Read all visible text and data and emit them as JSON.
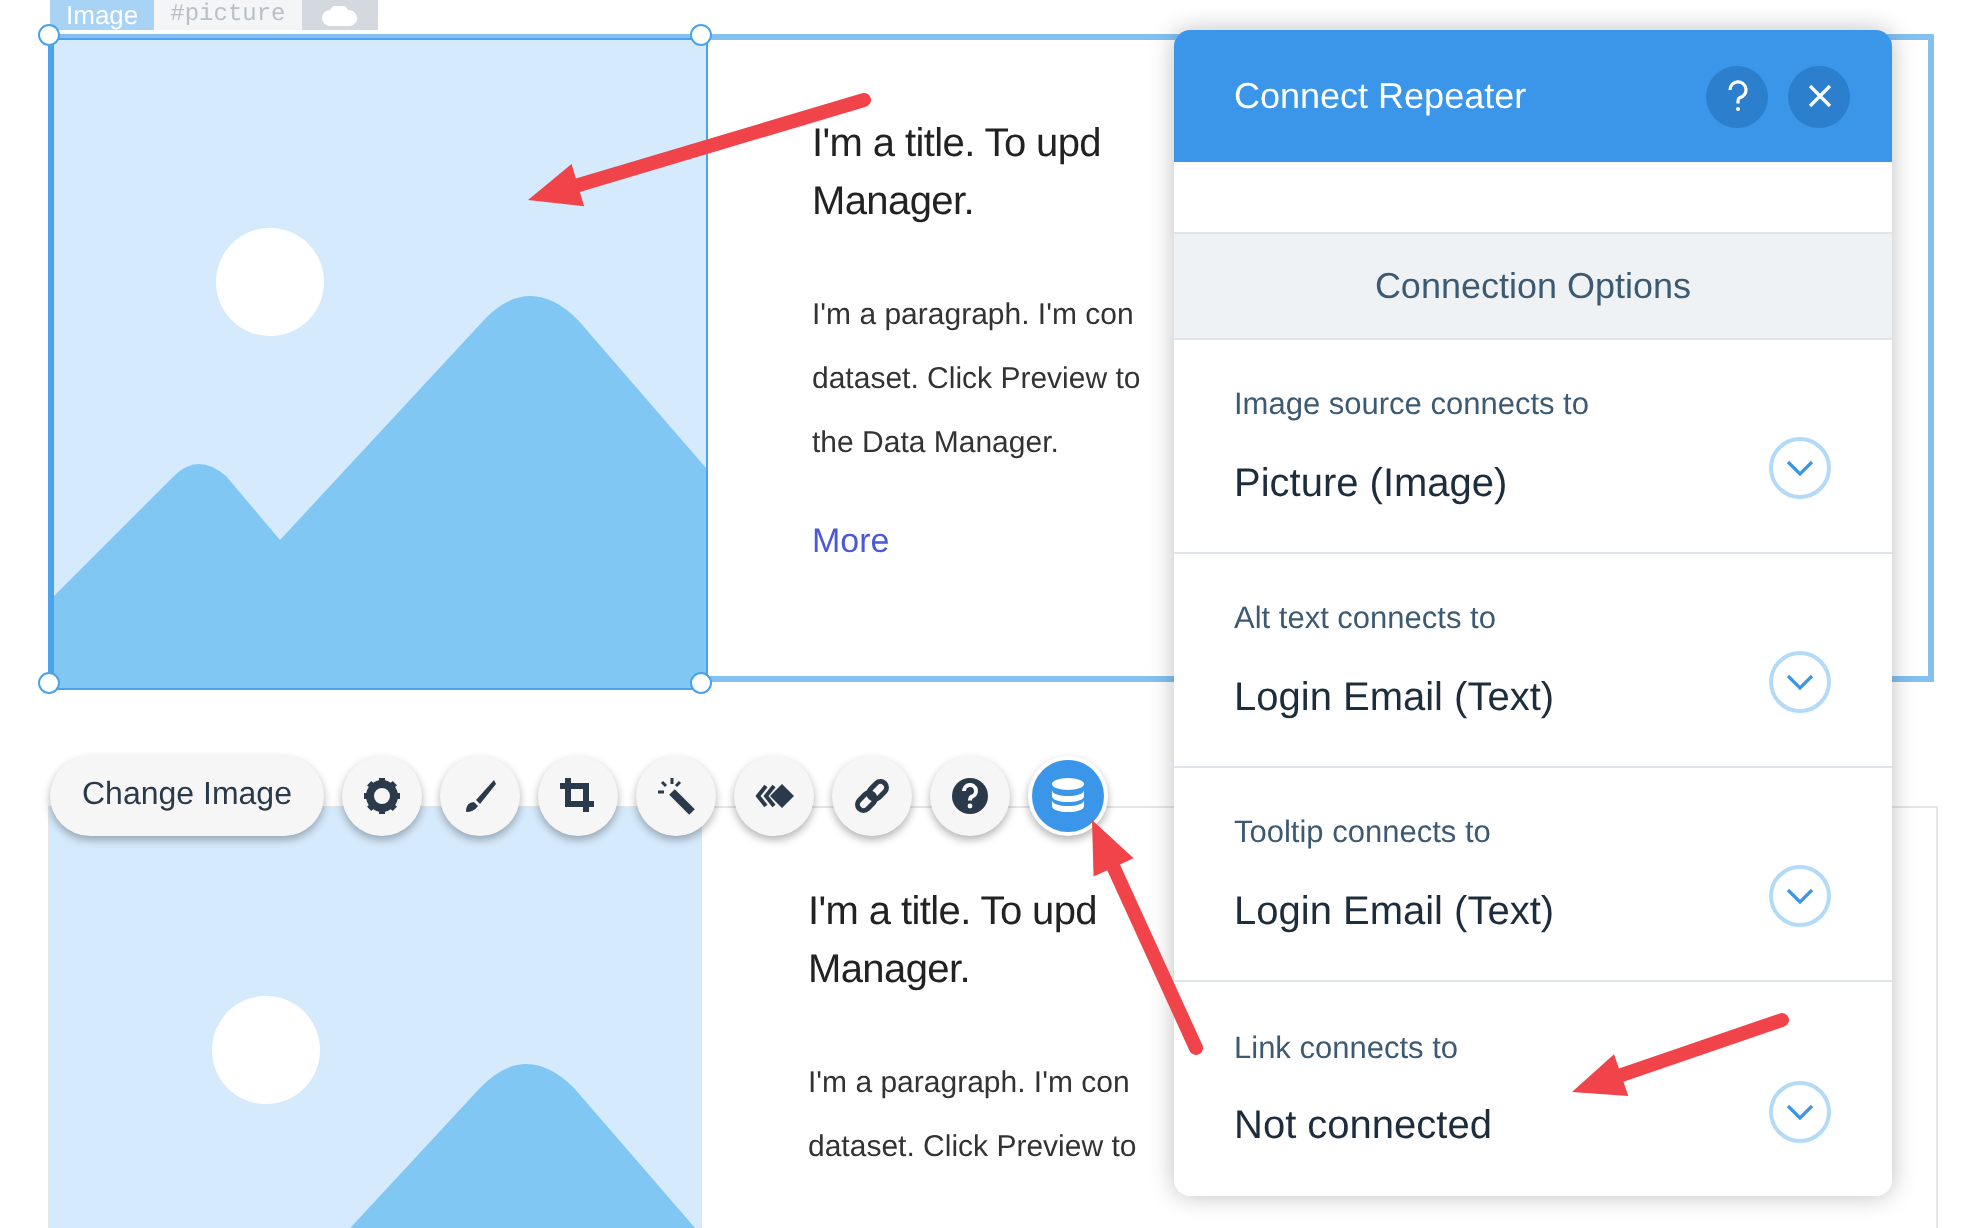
{
  "element_tag": {
    "type": "Image",
    "id": "#picture"
  },
  "repeater_items": [
    {
      "selected": true,
      "title_lines": [
        "I'm a title. To upd",
        "Manager."
      ],
      "paragraph_lines": [
        "I'm a paragraph. I'm con",
        "dataset. Click Preview to",
        "the Data Manager."
      ],
      "link": "More"
    },
    {
      "selected": false,
      "title_lines": [
        "I'm a title. To upd",
        "Manager."
      ],
      "paragraph_lines": [
        "I'm a paragraph. I'm con",
        "dataset. Click Preview to"
      ]
    }
  ],
  "toolbar": {
    "button": "Change Image",
    "tools": [
      {
        "kind": "settings",
        "selected": false
      },
      {
        "kind": "brush",
        "selected": false
      },
      {
        "kind": "crop",
        "selected": false
      },
      {
        "kind": "wand",
        "selected": false
      },
      {
        "kind": "animation",
        "selected": false
      },
      {
        "kind": "link",
        "selected": false
      },
      {
        "kind": "help",
        "selected": false
      },
      {
        "kind": "database",
        "selected": true
      }
    ]
  },
  "panel": {
    "title": "Connect Repeater",
    "section_header": "Connection Options",
    "connections": [
      {
        "label": "Image source connects to",
        "value": "Picture (Image)"
      },
      {
        "label": "Alt text connects to",
        "value": "Login Email (Text)"
      },
      {
        "label": "Tooltip connects to",
        "value": "Login Email (Text)"
      },
      {
        "label": "Link connects to",
        "value": "Not connected"
      }
    ]
  }
}
